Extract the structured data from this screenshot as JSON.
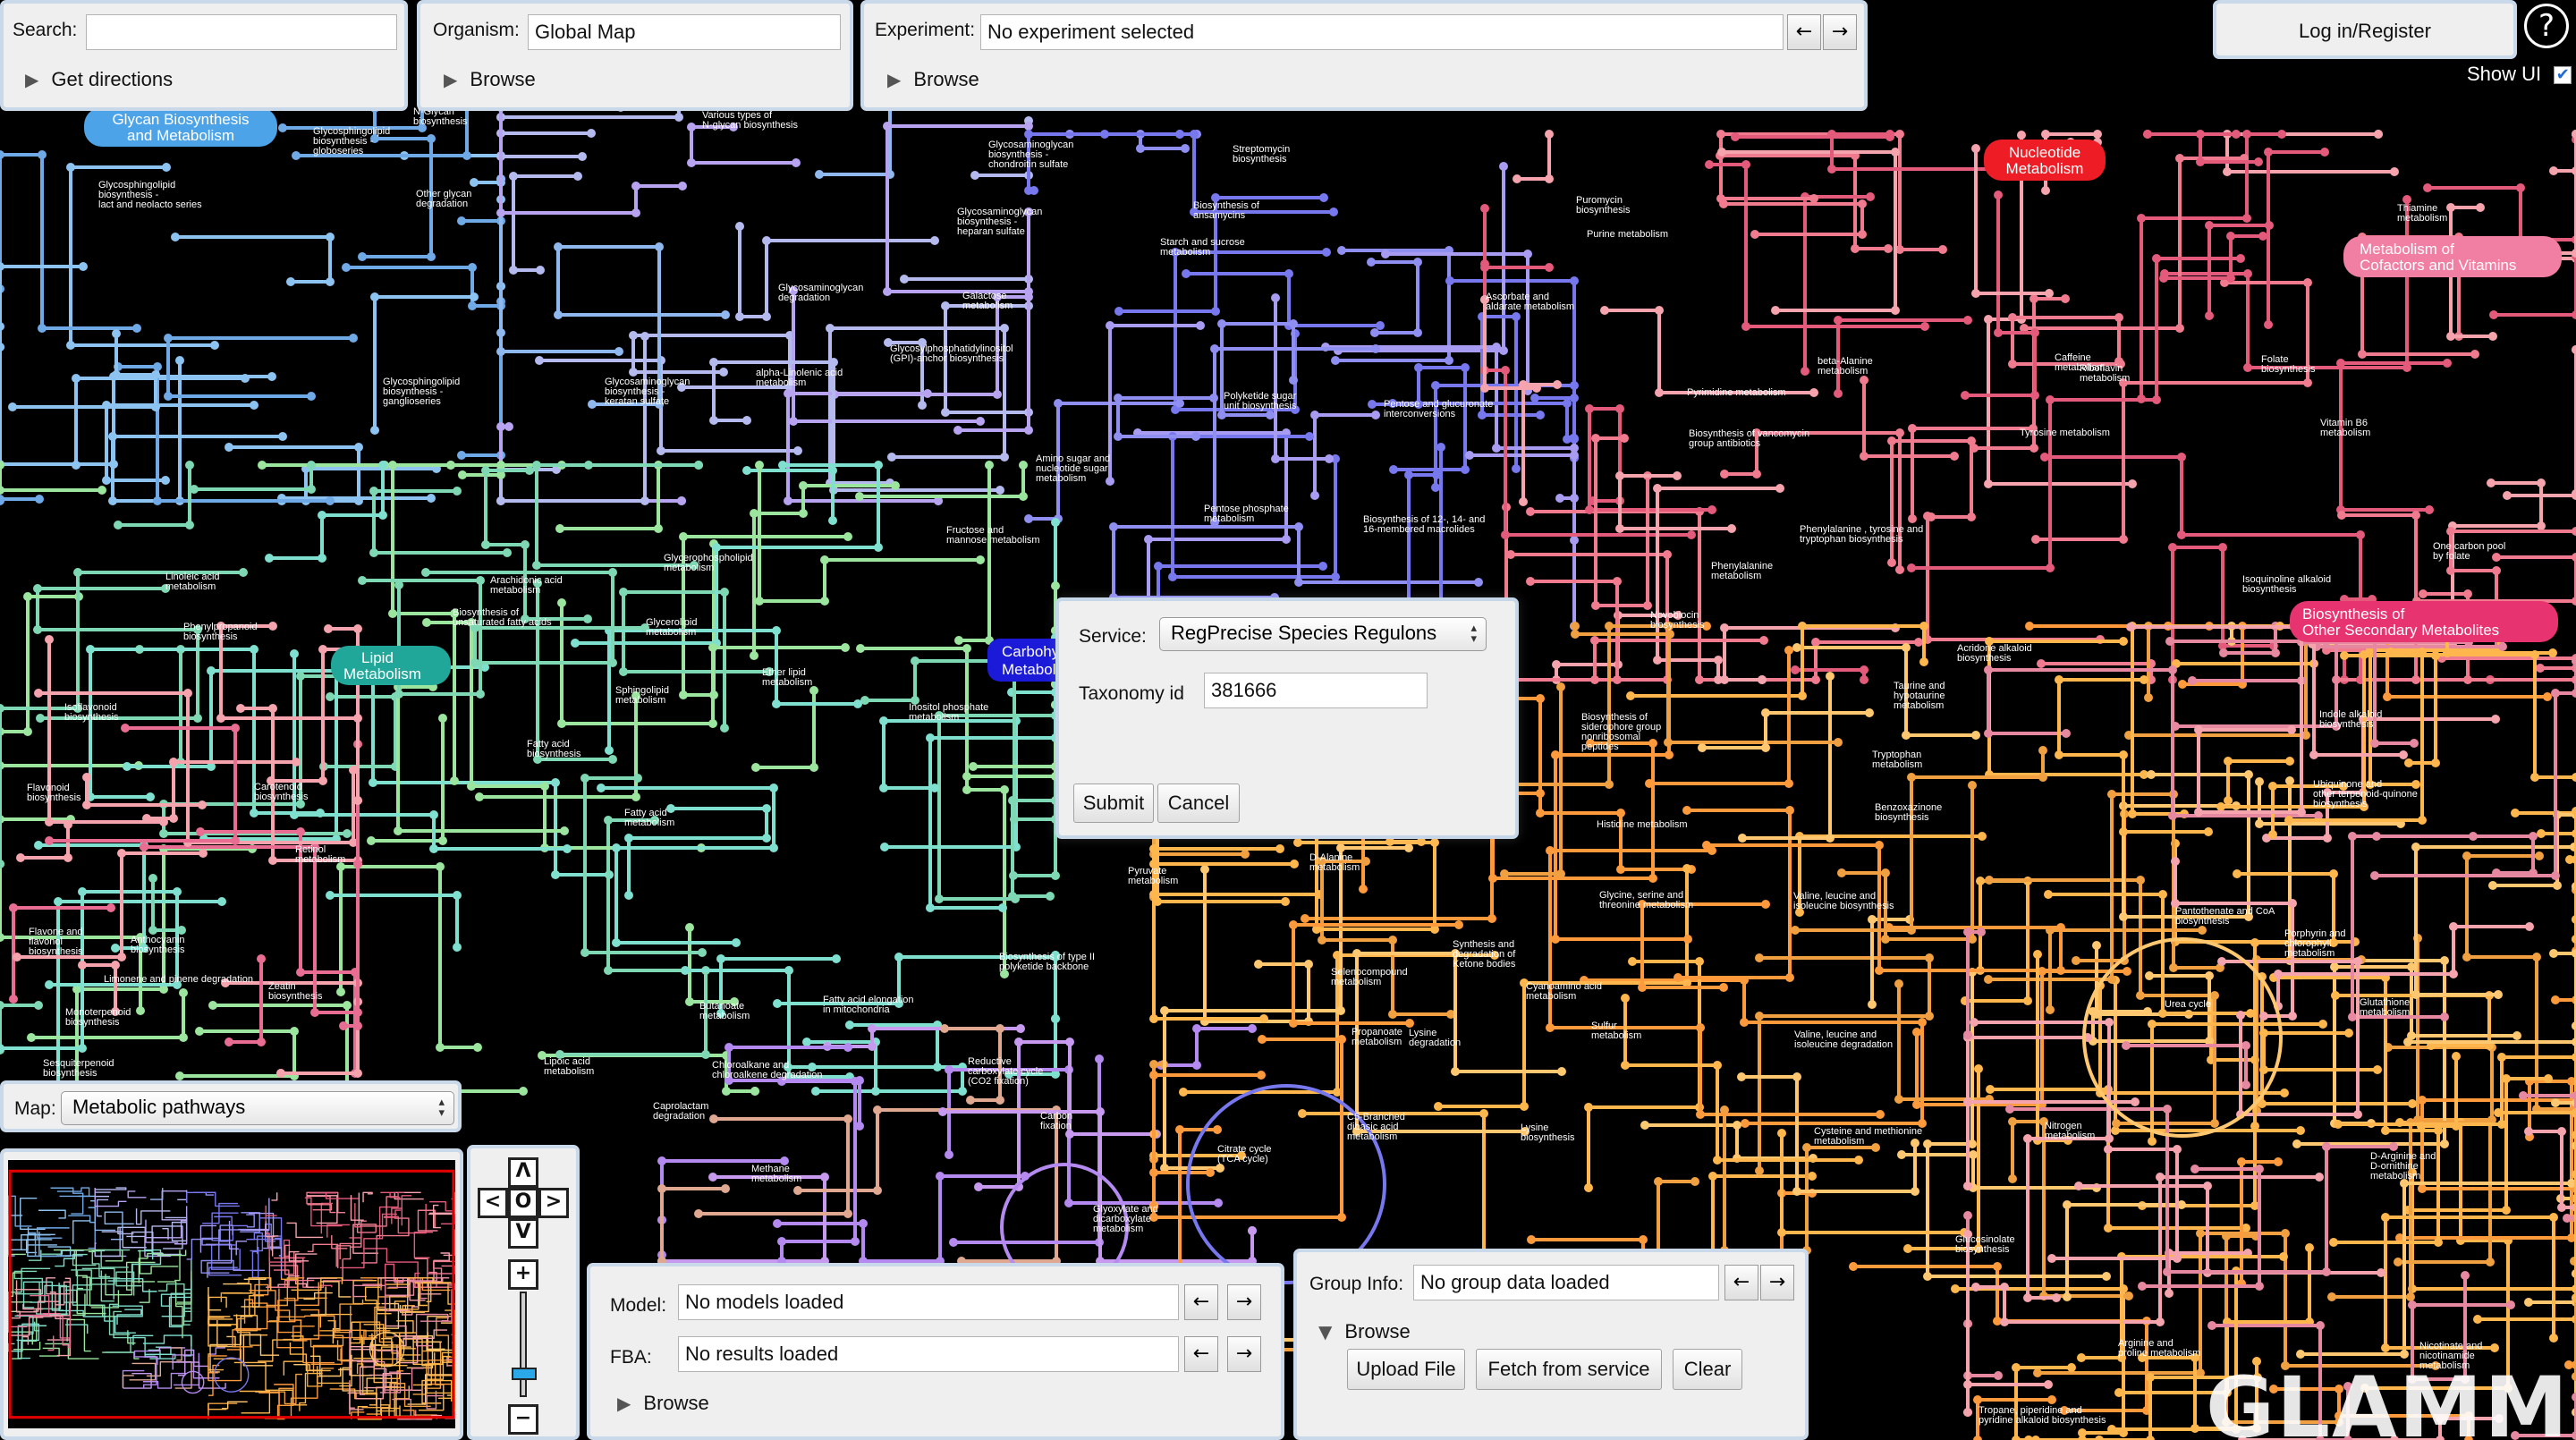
{
  "search": {
    "label": "Search:",
    "value": "",
    "directions": "Get directions"
  },
  "organism": {
    "label": "Organism:",
    "value": "Global Map",
    "browse": "Browse"
  },
  "experiment": {
    "label": "Experiment:",
    "value": "No experiment selected",
    "browse": "Browse",
    "prev": "←",
    "next": "→"
  },
  "account": {
    "login": "Log in/Register",
    "help": "?",
    "show_ui": "Show UI",
    "show_ui_checked": true
  },
  "map_select": {
    "label": "Map:",
    "value": "Metabolic pathways"
  },
  "dialog": {
    "service_label": "Service:",
    "service_value": "RegPrecise Species Regulons",
    "taxonomy_label": "Taxonomy id",
    "taxonomy_value": "381666",
    "submit": "Submit",
    "cancel": "Cancel"
  },
  "zoom": {
    "up": "Λ",
    "left": "<",
    "center": "O",
    "right": ">",
    "down": "V",
    "plus": "+",
    "minus": "−",
    "level": 0.22
  },
  "model_panel": {
    "model_label": "Model:",
    "model_value": "No models loaded",
    "fba_label": "FBA:",
    "fba_value": "No results loaded",
    "browse": "Browse",
    "prev": "←",
    "next": "→"
  },
  "group_panel": {
    "label": "Group Info:",
    "value": "No group data loaded",
    "browse": "Browse",
    "upload": "Upload File",
    "fetch": "Fetch from service",
    "clear": "Clear",
    "prev": "←",
    "next": "→"
  },
  "logo": "GLAMM",
  "categories": [
    {
      "lines": [
        "Glycan Biosynthesis",
        "and Metabolism"
      ],
      "color": "#4da3e8"
    },
    {
      "lines": [
        "Lipid",
        "Metabolism"
      ],
      "color": "#21a79a"
    },
    {
      "lines": [
        "Carbohydrate",
        "Metabolism"
      ],
      "color": "#1a1ad8"
    },
    {
      "lines": [
        "Nucleotide",
        "Metabolism"
      ],
      "color": "#ee1c24"
    },
    {
      "lines": [
        "Metabolism of",
        "Cofactors and Vitamins"
      ],
      "color": "#f07fa3"
    },
    {
      "lines": [
        "Biosynthesis of",
        "Other Secondary Metabolites"
      ],
      "color": "#e7336f"
    }
  ],
  "pathway_labels": [
    [
      "Glycosphingolipid",
      "biosynthesis -",
      "globoseries"
    ],
    [
      "Other glycan",
      "degradation"
    ],
    [
      "Glycosphingolipid",
      "biosynthesis -",
      "lact and neolacto series"
    ],
    [
      "N-Glycan",
      "biosynthesis"
    ],
    [
      "Various types of",
      "N-glycan biosynthesis"
    ],
    [
      "Glycosaminoglycan",
      "biosynthesis -",
      "chondroitin sulfate"
    ],
    [
      "Glycosaminoglycan",
      "biosynthesis -",
      "heparan sulfate"
    ],
    [
      "Glycosaminoglycan",
      "degradation"
    ],
    [
      "Glycosylphosphatidylinositol",
      "(GPI)-anchor biosynthesis"
    ],
    [
      "Glycosphingolipid",
      "biosynthesis -",
      "ganglioseries"
    ],
    [
      "Glycosaminoglycan",
      "biosynthesis -",
      "keratan sulfate"
    ],
    [
      "alpha-Linolenic acid",
      "metabolism"
    ],
    [
      "Streptomycin",
      "biosynthesis"
    ],
    [
      "Biosynthesis of",
      "ansamycins"
    ],
    [
      "Starch and sucrose",
      "metabolism"
    ],
    [
      "Galactose",
      "metabolism"
    ],
    [
      "Polyketide sugar",
      "unit biosynthesis"
    ],
    [
      "Pentose and glucuronate",
      "interconversions"
    ],
    [
      "Ascorbate and",
      "aldarate metabolism"
    ],
    [
      "Puromycin",
      "biosynthesis"
    ],
    [
      "Purine metabolism"
    ],
    [
      "Thiamine",
      "metabolism"
    ],
    [
      "Pyrimidine metabolism"
    ],
    [
      "beta-Alanine",
      "metabolism"
    ],
    [
      "Caffeine",
      "metabolism"
    ],
    [
      "Riboflavin",
      "metabolism"
    ],
    [
      "Folate",
      "biosynthesis"
    ],
    [
      "Vitamin B6",
      "metabolism"
    ],
    [
      "Biosynthesis of vancomycin",
      "group antibiotics"
    ],
    [
      "Tyrosine metabolism"
    ],
    [
      "Phenylalanine , tyrosine and",
      "tryptophan biosynthesis"
    ],
    [
      "One carbon pool",
      "by folate"
    ],
    [
      "Isoquinoline alkaloid",
      "biosynthesis"
    ],
    [
      "Amino sugar and",
      "nucleotide sugar",
      "metabolism"
    ],
    [
      "Pentose phosphate",
      "metabolism"
    ],
    [
      "Biosynthesis of 12-, 14- and",
      "16-membered macrolides"
    ],
    [
      "Fructose and",
      "mannose metabolism"
    ],
    [
      "Linoleic acid",
      "metabolism"
    ],
    [
      "Arachidonic acid",
      "metabolism"
    ],
    [
      "Glycerophospholipid",
      "metabolism"
    ],
    [
      "Phenylpropanoid",
      "biosynthesis"
    ],
    [
      "Biosynthesis of",
      "unsaturated fatty acids"
    ],
    [
      "Glycerolipid",
      "metabolism"
    ],
    [
      "Ether lipid",
      "metabolism"
    ],
    [
      "Sphingolipid",
      "metabolism"
    ],
    [
      "Inositol phosphate",
      "metabolism"
    ],
    [
      "Isoflavonoid",
      "biosynthesis"
    ],
    [
      "Flavonoid",
      "biosynthesis"
    ],
    [
      "Carotenoid",
      "biosynthesis"
    ],
    [
      "Fatty acid",
      "biosynthesis"
    ],
    [
      "Fatty acid",
      "metabolism"
    ],
    [
      "Retinol",
      "metabolism"
    ],
    [
      "Flavone and",
      "flavonol",
      "biosynthesis"
    ],
    [
      "Anthocyanin",
      "biosynthesis"
    ],
    [
      "Limonene and pinene degradation"
    ],
    [
      "Zeatin",
      "biosynthesis"
    ],
    [
      "Monoterpenoid",
      "biosynthesis"
    ],
    [
      "Sesquiterpenoid",
      "biosynthesis"
    ],
    [
      "Butanoate",
      "metabolism"
    ],
    [
      "Fatty acid elongation",
      "in mitochondria"
    ],
    [
      "Lipoic acid",
      "metabolism"
    ],
    [
      "Chloroalkane and",
      "chloroalkene degradation"
    ],
    [
      "Caprolactam",
      "degradation"
    ],
    [
      "Methane",
      "metabolism"
    ],
    [
      "Reductive",
      "carboxylate cycle",
      "(CO2 fixation)"
    ],
    [
      "Carbon",
      "fixation"
    ],
    [
      "Citrate cycle",
      "(TCA cycle)"
    ],
    [
      "Glyoxylate and",
      "dicarboxylate",
      "metabolism"
    ],
    [
      "Biosynthesis of type II",
      "polyketide backbone"
    ],
    [
      "Pyruvate",
      "metabolism"
    ],
    [
      "D-Alanine",
      "metabolism"
    ],
    [
      "Synthesis and",
      "degradation of",
      "Ketone bodies"
    ],
    [
      "Selenocompound",
      "metabolism"
    ],
    [
      "Propanoate",
      "metabolism"
    ],
    [
      "Lysine",
      "degradation"
    ],
    [
      "C5-Branched",
      "dibasic acid",
      "metabolism"
    ],
    [
      "Lysine",
      "biosynthesis"
    ],
    [
      "Cyanoamino acid",
      "metabolism"
    ],
    [
      "Sulfur",
      "metabolism"
    ],
    [
      "Histidine metabolism"
    ],
    [
      "Glycine, serine and",
      "threonine metabolism"
    ],
    [
      "Valine, leucine and",
      "isoleucine biosynthesis"
    ],
    [
      "Valine, leucine and",
      "isoleucine degradation"
    ],
    [
      "Cysteine and methionine",
      "metabolism"
    ],
    [
      "Nitrogen",
      "metabolism"
    ],
    [
      "Glucosinolate",
      "biosynthesis"
    ],
    [
      "Arginine and",
      "proline metabolism"
    ],
    [
      "Tropane, piperidine and",
      "pyridine alkaloid biosynthesis"
    ],
    [
      "Novobiocin",
      "biosynthesis"
    ],
    [
      "Phenylalanine",
      "metabolism"
    ],
    [
      "Taurine and",
      "hypotaurine",
      "metabolism"
    ],
    [
      "Tryptophan",
      "metabolism"
    ],
    [
      "Benzoxazinone",
      "biosynthesis"
    ],
    [
      "Indole alkaloid",
      "biosynthesis"
    ],
    [
      "Ubiquinone and",
      "other terpenoid-quinone",
      "biosynthesis"
    ],
    [
      "Pantothenate and CoA",
      "biosynthesis"
    ],
    [
      "Porphyrin and",
      "chlorophyll",
      "metabolism"
    ],
    [
      "Urea cycle"
    ],
    [
      "Glutathione",
      "metabolism"
    ],
    [
      "D-Arginine and",
      "D-ornithine",
      "metabolism"
    ],
    [
      "Nicotinate and",
      "nicotinamide",
      "metabolism"
    ],
    [
      "Biosynthesis of",
      "siderophore group",
      "nonribosomal",
      "peptides"
    ],
    [
      "Acridone alkaloid",
      "biosynthesis"
    ]
  ]
}
